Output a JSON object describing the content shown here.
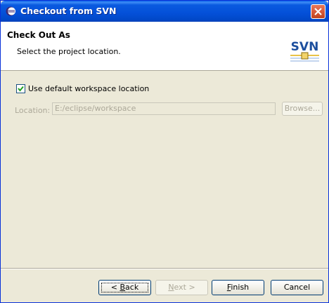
{
  "window": {
    "title": "Checkout from SVN"
  },
  "header": {
    "title": "Check Out As",
    "description": "Select the project location.",
    "logo_text": "SVN"
  },
  "form": {
    "use_default_workspace": {
      "label": "Use default workspace location",
      "checked": true
    },
    "location": {
      "label": "Location:",
      "value": "E:/eclipse/workspace",
      "enabled": false
    },
    "browse_label": "Browse..."
  },
  "footer": {
    "back_label_pre": "< ",
    "back_label_mnemonic": "B",
    "back_label_post": "ack",
    "next_label_mnemonic": "N",
    "next_label_post": "ext >",
    "finish_label_mnemonic": "F",
    "finish_label_post": "inish",
    "cancel_label": "Cancel"
  },
  "colors": {
    "titlebar": "#0450d8",
    "dialog_bg": "#ece9d8",
    "disabled_text": "#aca899",
    "close_button": "#d85a3a"
  }
}
